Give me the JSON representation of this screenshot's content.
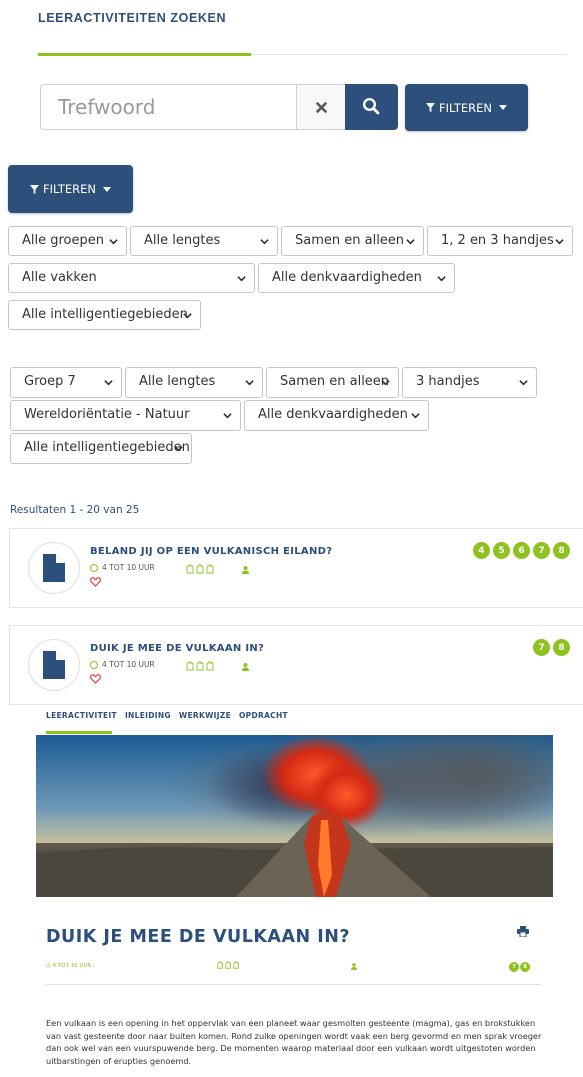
{
  "page": {
    "title": "LEERACTIVITEITEN ZOEKEN"
  },
  "search": {
    "placeholder": "Trefwoord",
    "filter_label": "FILTEREN"
  },
  "filters_default": {
    "button_label": "FILTEREN",
    "groep": "Alle groepen",
    "lengte": "Alle lengtes",
    "samenwerking": "Samen en alleen",
    "handjes": "1, 2 en 3 handjes",
    "vak": "Alle vakken",
    "denkvaardigheid": "Alle denkvaardigheden",
    "intelligentie": "Alle intelligentiegebieden"
  },
  "filters_selected": {
    "groep": "Groep 7",
    "lengte": "Alle lengtes",
    "samenwerking": "Samen en alleen",
    "handjes": "3 handjes",
    "vak": "Wereldoriëntatie - Natuur",
    "denkvaardigheid": "Alle denkvaardigheden",
    "intelligentie": "Alle intelligentiegebieden"
  },
  "results": {
    "count_text": "Resultaten 1 - 20 van 25",
    "items": [
      {
        "title": "BELAND JIJ OP EEN VULKANISCH EILAND?",
        "duration": "4 TOT 10 UUR",
        "hands": "✋✋✋",
        "groups": [
          "4",
          "5",
          "6",
          "7",
          "8"
        ]
      },
      {
        "title": "DUIK JE MEE DE VULKAAN IN?",
        "duration": "4 TOT 10 UUR",
        "hands": "✋✋✋",
        "groups": [
          "7",
          "8"
        ]
      }
    ]
  },
  "detail": {
    "tabs": [
      "LEERACTIVITEIT",
      "INLEIDING",
      "WERKWIJZE",
      "OPDRACHT"
    ],
    "title": "DUIK JE MEE DE VULKAAN IN?",
    "duration": "4 TOT 10 UUR",
    "groups": [
      "7",
      "8"
    ],
    "description": "Een vulkaan is een opening in het oppervlak van een planeet waar gesmolten gesteente (magma), gas en brokstukken van vast gesteente door naar buiten komen. Rond zulke openingen wordt vaak een berg gevormd en men sprak vroeger dan ook wel van een vuurspuwende berg. De momenten waarop materiaal door een vulkaan wordt uitgestoten worden uitbarstingen of erupties genoemd."
  },
  "colors": {
    "brand_blue": "#2c4f7c",
    "accent_green": "#8dc21f",
    "heart_red": "#e0473a"
  }
}
